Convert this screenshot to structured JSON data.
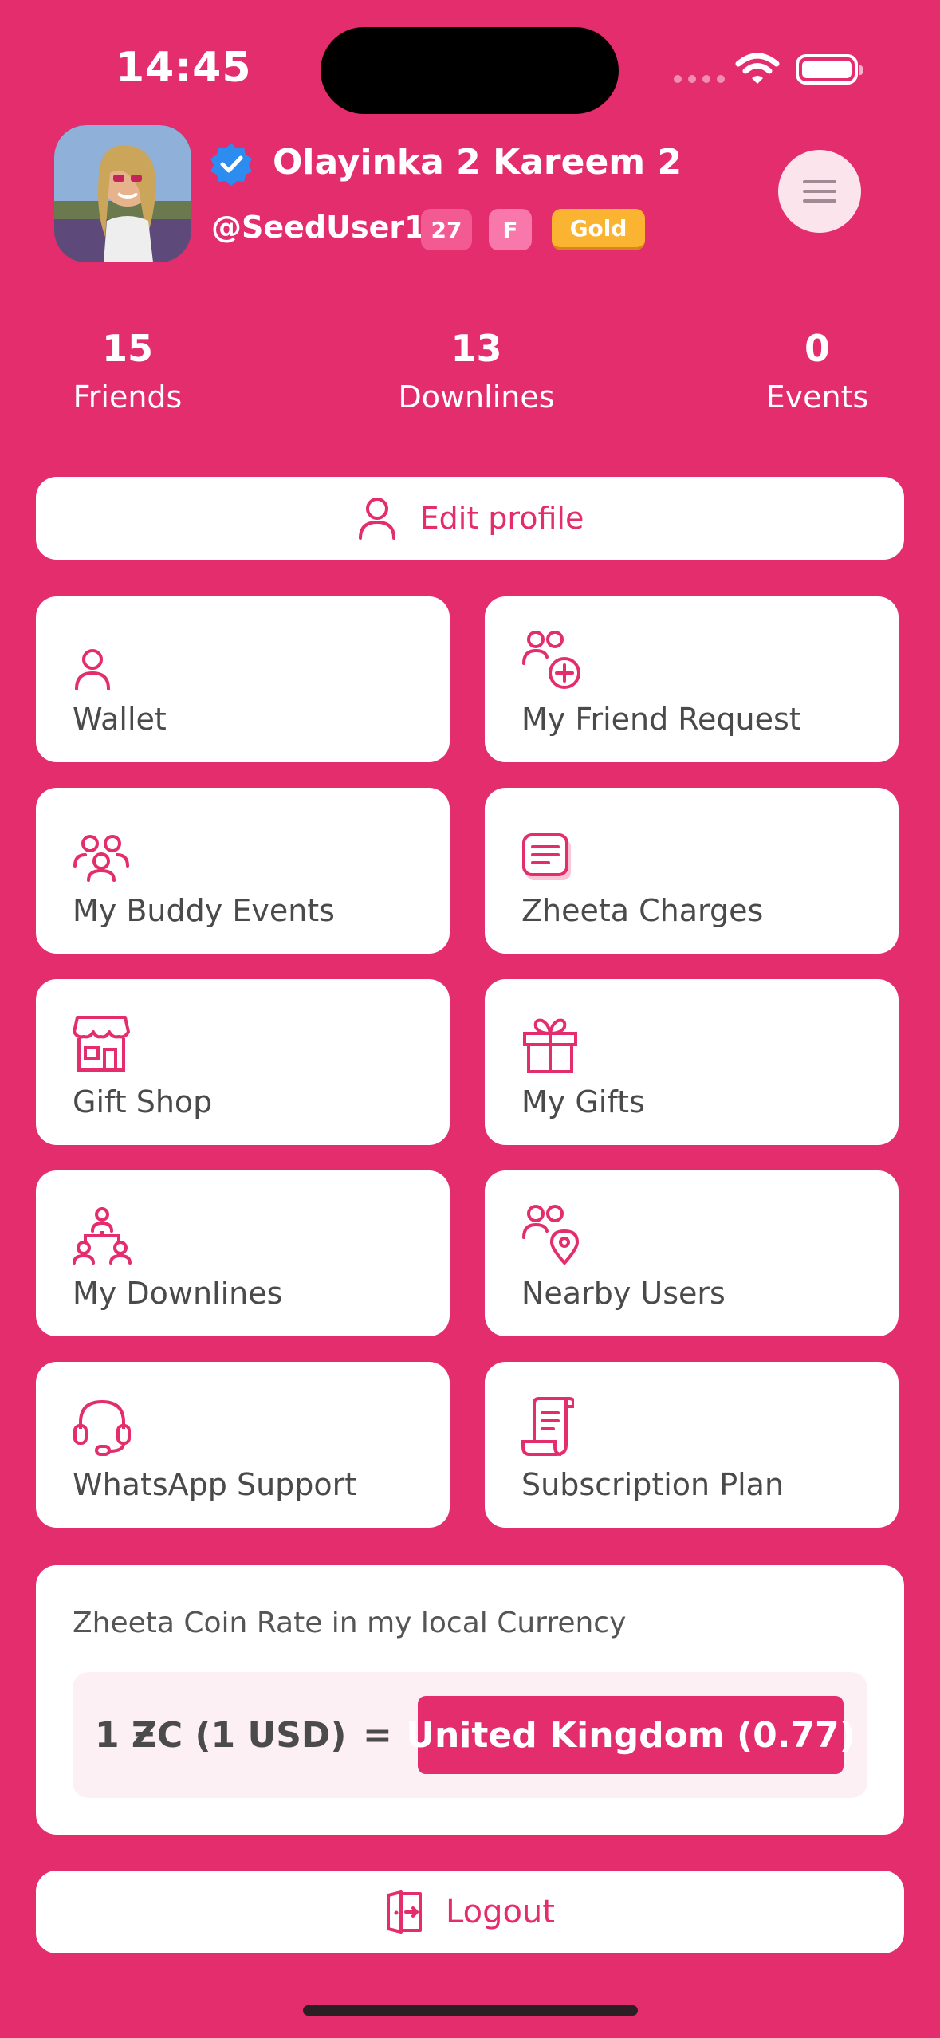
{
  "status_bar": {
    "time": "14:45"
  },
  "profile": {
    "name": "Olayinka 2 Kareem 2",
    "handle": "@SeedUser1",
    "age": "27",
    "gender": "F",
    "tier": "Gold"
  },
  "stats": [
    {
      "value": "15",
      "label": "Friends"
    },
    {
      "value": "13",
      "label": "Downlines"
    },
    {
      "value": "0",
      "label": "Events"
    }
  ],
  "edit_profile": {
    "label": "Edit profile",
    "icon": "person-icon"
  },
  "menu_tiles": [
    {
      "label": "Wallet",
      "icon": "person-icon"
    },
    {
      "label": "My Friend Request",
      "icon": "add-friends-icon"
    },
    {
      "label": "My Buddy Events",
      "icon": "group-icon"
    },
    {
      "label": "Zheeta Charges",
      "icon": "receipt-list-icon"
    },
    {
      "label": "Gift Shop",
      "icon": "shop-icon"
    },
    {
      "label": "My Gifts",
      "icon": "gift-icon"
    },
    {
      "label": "My Downlines",
      "icon": "hierarchy-icon"
    },
    {
      "label": "Nearby Users",
      "icon": "users-location-icon"
    },
    {
      "label": "WhatsApp Support",
      "icon": "headset-icon"
    },
    {
      "label": "Subscription Plan",
      "icon": "scroll-icon"
    }
  ],
  "coin_rate": {
    "title": "Zheeta Coin Rate in my local Currency",
    "base": "1 ƵC (1 USD)",
    "equals": "=",
    "value": "United Kingdom (0.77)"
  },
  "logout": {
    "label": "Logout",
    "icon": "logout-door-icon"
  },
  "colors": {
    "primary": "#E42D6D",
    "gold": "#FBB332",
    "card": "#FFFFFF",
    "text": "#4A4A4A"
  }
}
